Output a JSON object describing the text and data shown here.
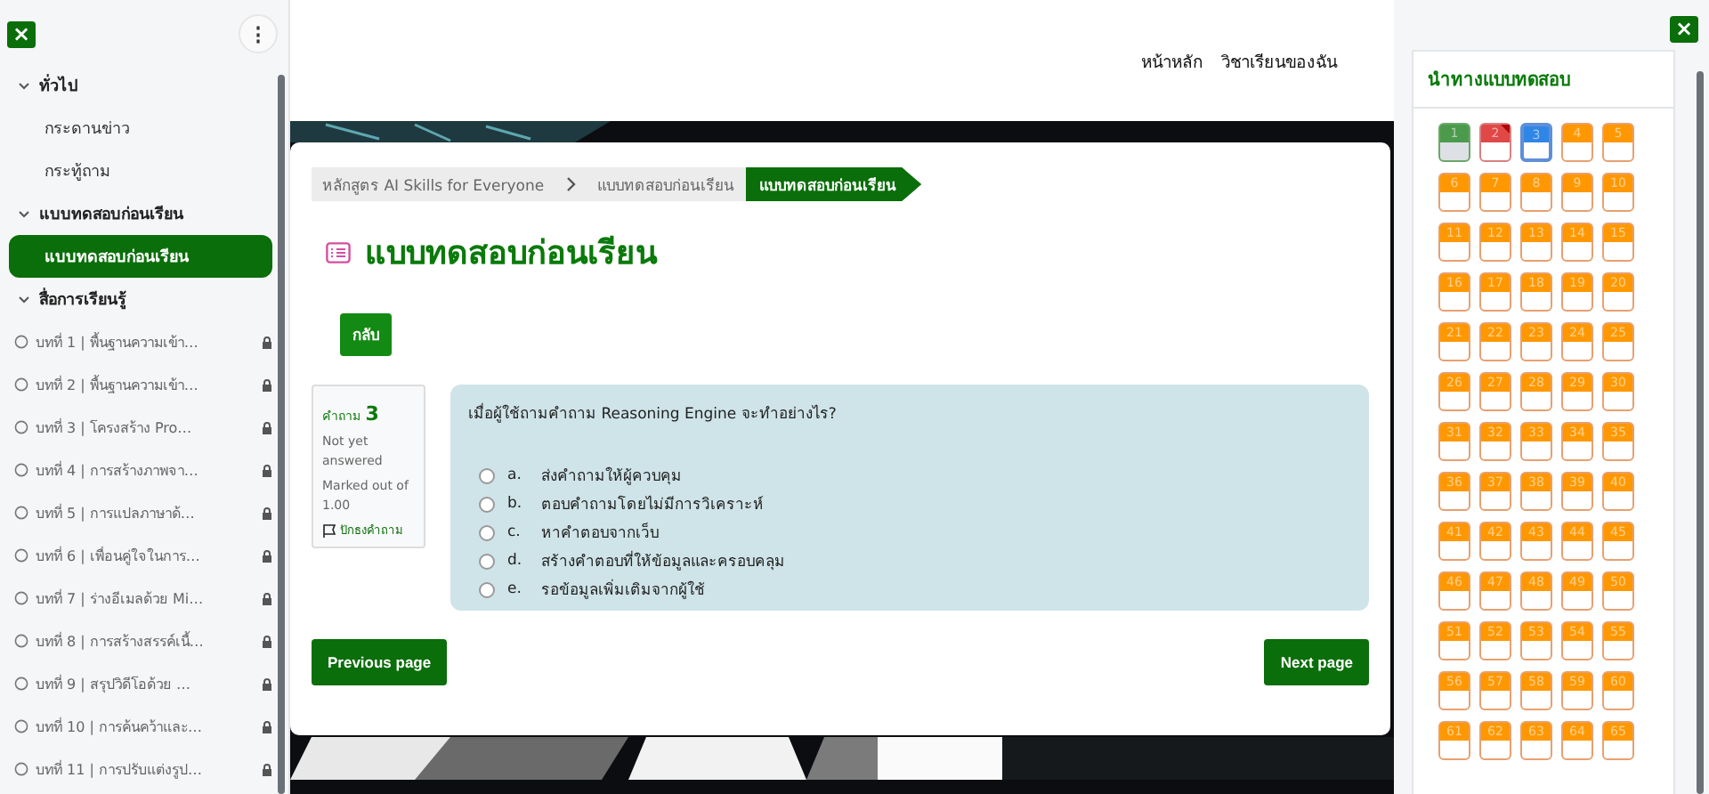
{
  "left_drawer": {
    "close": "×",
    "menu": "⋮",
    "sections": [
      {
        "title": "ทั่วไป",
        "expanded": true,
        "items": [
          {
            "label": "กระดานข่าว",
            "kind": "link",
            "selected": false
          },
          {
            "label": "กระทู้ถาม",
            "kind": "link",
            "selected": false
          }
        ]
      },
      {
        "title": "แบบทดสอบก่อนเรียน",
        "expanded": true,
        "items": [
          {
            "label": "แบบทดสอบก่อนเรียน",
            "kind": "link",
            "selected": true
          }
        ]
      },
      {
        "title": "สื่อการเรียนรู้",
        "expanded": true,
        "items": [
          {
            "label": "บทที่ 1 | พื้นฐานความเข้า…",
            "kind": "lesson",
            "locked": true,
            "selected": false
          },
          {
            "label": "บทที่ 2 | พื้นฐานความเข้า…",
            "kind": "lesson",
            "locked": true,
            "selected": false
          },
          {
            "label": "บทที่ 3 | โครงสร้าง Pro…",
            "kind": "lesson",
            "locked": true,
            "selected": false
          },
          {
            "label": "บทที่ 4 | การสร้างภาพจา…",
            "kind": "lesson",
            "locked": true,
            "selected": false
          },
          {
            "label": "บทที่ 5 | การแปลภาษาด้…",
            "kind": "lesson",
            "locked": true,
            "selected": false
          },
          {
            "label": "บทที่ 6 | เพื่อนคู่ใจในการ…",
            "kind": "lesson",
            "locked": true,
            "selected": false
          },
          {
            "label": "บทที่ 7 | ร่างอีเมลด้วย Mi…",
            "kind": "lesson",
            "locked": true,
            "selected": false
          },
          {
            "label": "บทที่ 8 | การสร้างสรรค์เนื้…",
            "kind": "lesson",
            "locked": true,
            "selected": false
          },
          {
            "label": "บทที่ 9 | สรุปวิดีโอด้วย …",
            "kind": "lesson",
            "locked": true,
            "selected": false
          },
          {
            "label": "บทที่ 10 | การค้นคว้าและ…",
            "kind": "lesson",
            "locked": true,
            "selected": false
          },
          {
            "label": "บทที่ 11 | การปรับแต่งรูป…",
            "kind": "lesson",
            "locked": true,
            "selected": false
          }
        ]
      }
    ]
  },
  "top_nav": [
    "หน้าหลัก",
    "วิชาเรียนของฉัน"
  ],
  "breadcrumb": [
    {
      "label": "หลักสูตร AI Skills for Everyone",
      "selected": false
    },
    {
      "label": "แบบทดสอบก่อนเรียน",
      "selected": false
    },
    {
      "label": "แบบทดสอบก่อนเรียน",
      "selected": true
    }
  ],
  "page_title": "แบบทดสอบก่อนเรียน",
  "back_button": "กลับ",
  "question_info": {
    "label": "คำถาม",
    "number": "3",
    "status": "Not yet answered",
    "marks": "Marked out of 1.00",
    "flag": "ปักธงคำถาม",
    "flagged": false
  },
  "question": {
    "text": "เมื่อผู้ใช้ถามคำถาม Reasoning Engine จะทำอย่างไร?",
    "options": [
      {
        "letter": "a.",
        "text": "ส่งคำถามให้ผู้ควบคุม",
        "selected": false
      },
      {
        "letter": "b.",
        "text": "ตอบคำถามโดยไม่มีการวิเคราะห์",
        "selected": false
      },
      {
        "letter": "c.",
        "text": "หาคำตอบจากเว็บ",
        "selected": false
      },
      {
        "letter": "d.",
        "text": "สร้างคำตอบที่ให้ข้อมูลและครอบคลุม",
        "selected": false
      },
      {
        "letter": "e.",
        "text": "รอข้อมูลเพิ่มเติมจากผู้ใช้",
        "selected": false
      }
    ]
  },
  "buttons": [
    "Previous page",
    "Next page"
  ],
  "right_drawer": {
    "close": "×",
    "title": "นำทางแบบทดสอบ",
    "questions": [
      {
        "label": "1",
        "answered": true,
        "flagged": false,
        "selected": false
      },
      {
        "label": "2",
        "answered": false,
        "flagged": true,
        "selected": false
      },
      {
        "label": "3",
        "answered": false,
        "flagged": false,
        "selected": true
      },
      {
        "label": "4",
        "answered": false,
        "flagged": false,
        "selected": false
      },
      {
        "label": "5",
        "answered": false,
        "flagged": false,
        "selected": false
      },
      {
        "label": "6",
        "answered": false,
        "flagged": false,
        "selected": false
      },
      {
        "label": "7",
        "answered": false,
        "flagged": false,
        "selected": false
      },
      {
        "label": "8",
        "answered": false,
        "flagged": false,
        "selected": false
      },
      {
        "label": "9",
        "answered": false,
        "flagged": false,
        "selected": false
      },
      {
        "label": "10",
        "answered": false,
        "flagged": false,
        "selected": false
      },
      {
        "label": "11",
        "answered": false,
        "flagged": false,
        "selected": false
      },
      {
        "label": "12",
        "answered": false,
        "flagged": false,
        "selected": false
      },
      {
        "label": "13",
        "answered": false,
        "flagged": false,
        "selected": false
      },
      {
        "label": "14",
        "answered": false,
        "flagged": false,
        "selected": false
      },
      {
        "label": "15",
        "answered": false,
        "flagged": false,
        "selected": false
      },
      {
        "label": "16",
        "answered": false,
        "flagged": false,
        "selected": false
      },
      {
        "label": "17",
        "answered": false,
        "flagged": false,
        "selected": false
      },
      {
        "label": "18",
        "answered": false,
        "flagged": false,
        "selected": false
      },
      {
        "label": "19",
        "answered": false,
        "flagged": false,
        "selected": false
      },
      {
        "label": "20",
        "answered": false,
        "flagged": false,
        "selected": false
      },
      {
        "label": "21",
        "answered": false,
        "flagged": false,
        "selected": false
      },
      {
        "label": "22",
        "answered": false,
        "flagged": false,
        "selected": false
      },
      {
        "label": "23",
        "answered": false,
        "flagged": false,
        "selected": false
      },
      {
        "label": "24",
        "answered": false,
        "flagged": false,
        "selected": false
      },
      {
        "label": "25",
        "answered": false,
        "flagged": false,
        "selected": false
      },
      {
        "label": "26",
        "answered": false,
        "flagged": false,
        "selected": false
      },
      {
        "label": "27",
        "answered": false,
        "flagged": false,
        "selected": false
      },
      {
        "label": "28",
        "answered": false,
        "flagged": false,
        "selected": false
      },
      {
        "label": "29",
        "answered": false,
        "flagged": false,
        "selected": false
      },
      {
        "label": "30",
        "answered": false,
        "flagged": false,
        "selected": false
      },
      {
        "label": "31",
        "answered": false,
        "flagged": false,
        "selected": false
      },
      {
        "label": "32",
        "answered": false,
        "flagged": false,
        "selected": false
      },
      {
        "label": "33",
        "answered": false,
        "flagged": false,
        "selected": false
      },
      {
        "label": "34",
        "answered": false,
        "flagged": false,
        "selected": false
      },
      {
        "label": "35",
        "answered": false,
        "flagged": false,
        "selected": false
      },
      {
        "label": "36",
        "answered": false,
        "flagged": false,
        "selected": false
      },
      {
        "label": "37",
        "answered": false,
        "flagged": false,
        "selected": false
      },
      {
        "label": "38",
        "answered": false,
        "flagged": false,
        "selected": false
      },
      {
        "label": "39",
        "answered": false,
        "flagged": false,
        "selected": false
      },
      {
        "label": "40",
        "answered": false,
        "flagged": false,
        "selected": false
      },
      {
        "label": "41",
        "answered": false,
        "flagged": false,
        "selected": false
      },
      {
        "label": "42",
        "answered": false,
        "flagged": false,
        "selected": false
      },
      {
        "label": "43",
        "answered": false,
        "flagged": false,
        "selected": false
      },
      {
        "label": "44",
        "answered": false,
        "flagged": false,
        "selected": false
      },
      {
        "label": "45",
        "answered": false,
        "flagged": false,
        "selected": false
      },
      {
        "label": "46",
        "answered": false,
        "flagged": false,
        "selected": false
      },
      {
        "label": "47",
        "answered": false,
        "flagged": false,
        "selected": false
      },
      {
        "label": "48",
        "answered": false,
        "flagged": false,
        "selected": false
      },
      {
        "label": "49",
        "answered": false,
        "flagged": false,
        "selected": false
      },
      {
        "label": "50",
        "answered": false,
        "flagged": false,
        "selected": false
      },
      {
        "label": "51",
        "answered": false,
        "flagged": false,
        "selected": false
      },
      {
        "label": "52",
        "answered": false,
        "flagged": false,
        "selected": false
      },
      {
        "label": "53",
        "answered": false,
        "flagged": false,
        "selected": false
      },
      {
        "label": "54",
        "answered": false,
        "flagged": false,
        "selected": false
      },
      {
        "label": "55",
        "answered": false,
        "flagged": false,
        "selected": false
      },
      {
        "label": "56",
        "answered": false,
        "flagged": false,
        "selected": false
      },
      {
        "label": "57",
        "answered": false,
        "flagged": false,
        "selected": false
      },
      {
        "label": "58",
        "answered": false,
        "flagged": false,
        "selected": false
      },
      {
        "label": "59",
        "answered": false,
        "flagged": false,
        "selected": false
      },
      {
        "label": "60",
        "answered": false,
        "flagged": false,
        "selected": false
      },
      {
        "label": "61",
        "answered": false,
        "flagged": false,
        "selected": false
      },
      {
        "label": "62",
        "answered": false,
        "flagged": false,
        "selected": false
      },
      {
        "label": "63",
        "answered": false,
        "flagged": false,
        "selected": false
      },
      {
        "label": "64",
        "answered": false,
        "flagged": false,
        "selected": false
      },
      {
        "label": "65",
        "answered": false,
        "flagged": false,
        "selected": false
      }
    ]
  }
}
